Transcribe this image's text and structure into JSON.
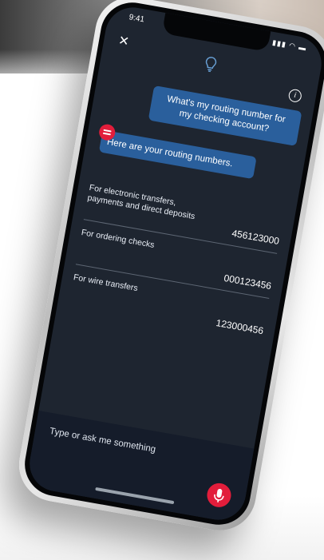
{
  "status": {
    "time": "9:41",
    "icons": "▮▮▮ ◠ ▬"
  },
  "header": {
    "info_symbol": "i",
    "close_symbol": "✕"
  },
  "chat": {
    "user_message": "What's my routing number for my checking account?",
    "bot_message": "Here are your routing numbers."
  },
  "routing": [
    {
      "label": "For electronic transfers, payments and direct deposits",
      "value": "456123000"
    },
    {
      "label": "For ordering checks",
      "value": "000123456"
    },
    {
      "label": "For wire transfers",
      "value": "123000456"
    }
  ],
  "composer": {
    "placeholder": "Type or ask me something"
  },
  "colors": {
    "screen_bg": "#1e2530",
    "bubble": "#2a5f9c",
    "accent": "#e21d3b"
  }
}
